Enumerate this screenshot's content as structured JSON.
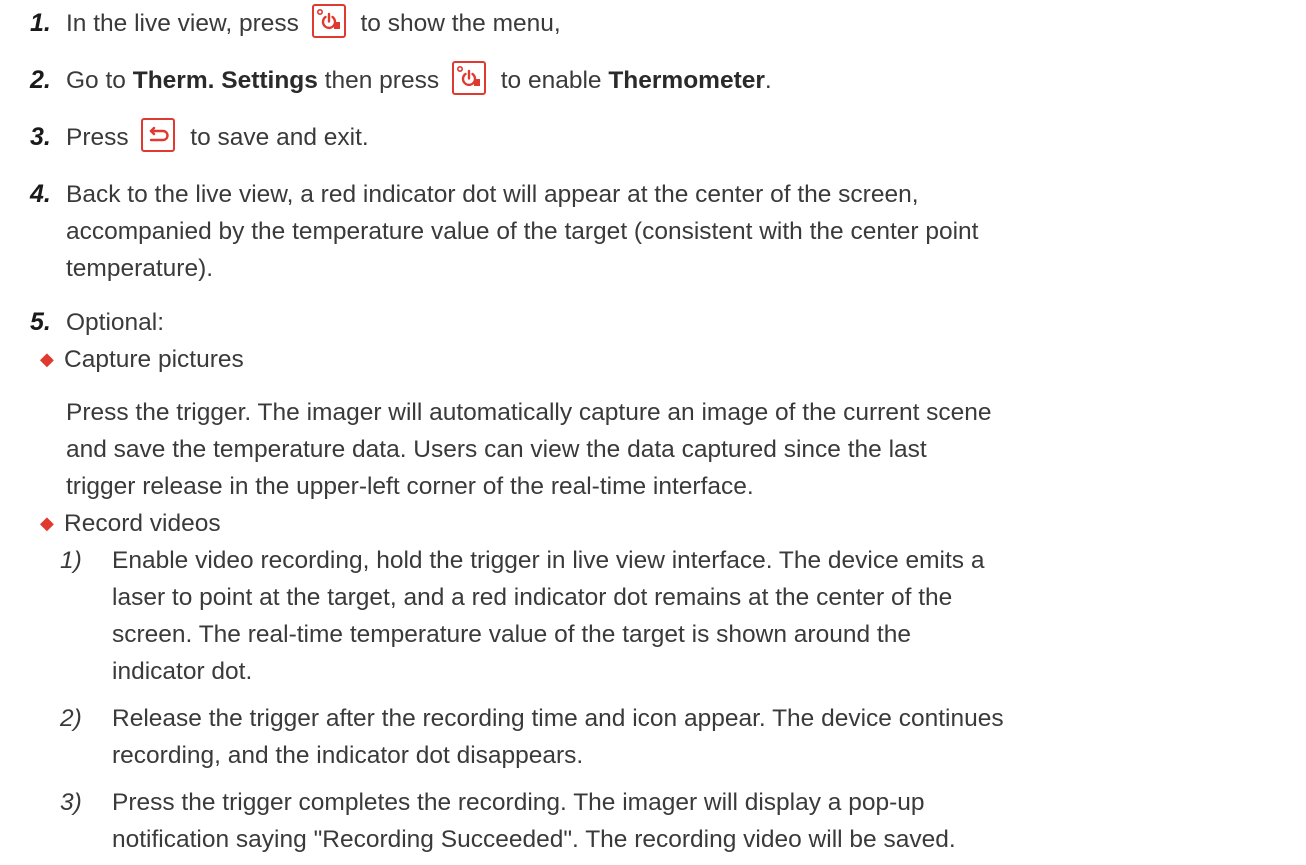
{
  "steps": [
    {
      "num": "1.",
      "pre": "In the live view, press",
      "icon": "power-menu-icon",
      "post": "to show the menu,"
    },
    {
      "num": "2.",
      "pre": "Go to ",
      "bold1": "Therm. Settings",
      "mid": " then press",
      "icon": "power-menu-icon",
      "post": "to enable ",
      "bold2": "Thermometer",
      "end": "."
    },
    {
      "num": "3.",
      "pre": "Press",
      "icon": "back-return-icon",
      "post": "to save and exit."
    },
    {
      "num": "4.",
      "lines": [
        "Back to the live view, a red indicator dot will appear at the center of the screen,",
        "accompanied by the temperature value of the target (consistent with the center point",
        "temperature)."
      ]
    },
    {
      "num": "5.",
      "text": "Optional:"
    }
  ],
  "optional": {
    "capture": {
      "title": "Capture pictures",
      "lines": [
        "Press the trigger. The imager will automatically capture an image of the current scene",
        "and save the temperature data. Users can view the data captured since the last",
        "trigger release in the upper-left corner of the real-time interface."
      ]
    },
    "record": {
      "title": "Record videos",
      "substeps": [
        {
          "num": "1)",
          "lines": [
            "Enable video recording, hold the trigger in live view interface. The device emits a",
            "laser to point at the target, and a red indicator dot remains at the center of the",
            "screen. The real-time temperature value of the target is shown around the",
            "indicator dot."
          ]
        },
        {
          "num": "2)",
          "lines": [
            "Release the trigger after the recording time and icon appear. The device continues",
            "recording, and the indicator dot disappears."
          ]
        },
        {
          "num": "3)",
          "lines": [
            "Press the trigger completes the recording. The imager will display a pop-up",
            "notification saying \"Recording Succeeded\". The recording video will be saved."
          ]
        }
      ]
    }
  },
  "colors": {
    "accent": "#e03a30",
    "text": "#3a3a3a"
  }
}
